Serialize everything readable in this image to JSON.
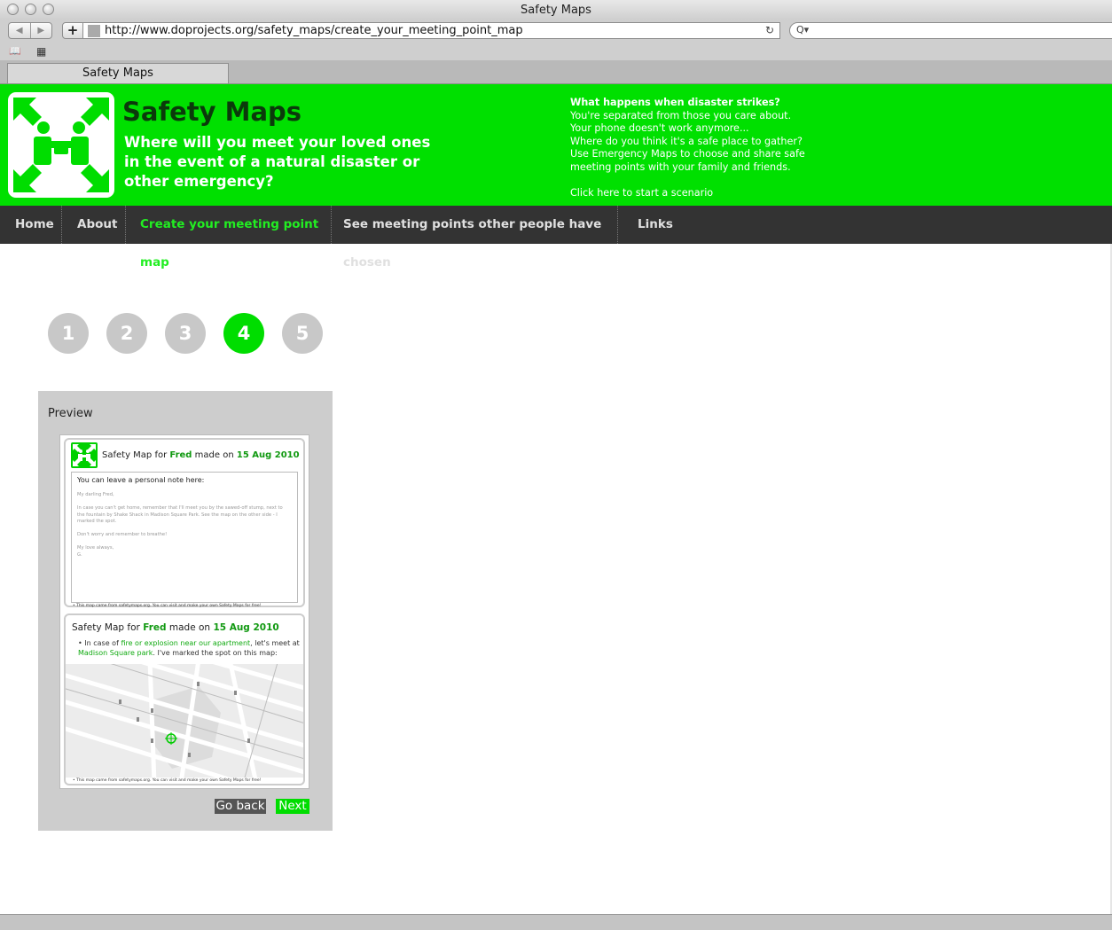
{
  "browser": {
    "window_title": "Safety Maps",
    "url": "http://www.doprojects.org/safety_maps/create_your_meeting_point_map",
    "tab_title": "Safety Maps",
    "back_glyph": "◀",
    "forward_glyph": "▶",
    "plus_glyph": "+",
    "reload_glyph": "↻",
    "search_glyph": "Q▾",
    "bookmarks_glyph": "📖",
    "topsites_glyph": "▦"
  },
  "header": {
    "title": "Safety Maps",
    "tagline": "Where will you meet your loved ones in the event of a natural disaster or other emergency?",
    "story_lines": [
      "What happens when disaster strikes?",
      "You're separated from those you care about.",
      "Your phone doesn't work anymore...",
      "Where do you think it's a safe place to gather?",
      "Use Emergency Maps to choose and share safe",
      "meeting points with your family and friends."
    ],
    "scenario_link": "Click here to start a scenario"
  },
  "nav": {
    "items": [
      {
        "label": "Home"
      },
      {
        "label": "About"
      },
      {
        "label": "Create your meeting point map"
      },
      {
        "label": "See meeting points other people have chosen"
      },
      {
        "label": "Links"
      }
    ],
    "active_index": 2
  },
  "steps": {
    "items": [
      "1",
      "2",
      "3",
      "4",
      "5"
    ],
    "current": "4"
  },
  "preview": {
    "title": "Preview",
    "card1": {
      "head_prefix": "Safety Map for",
      "name": "Fred",
      "made_on": "made on",
      "date": "15 Aug 2010",
      "note_label": "You can leave a personal note here:",
      "note_lines": [
        "My darling Fred,",
        "",
        "In case you can't get home, remember that I'll meet you by the sawed-off stump, next to the fountain by Shake Shack in Madison Square Park. See the map on the other side - I marked the spot.",
        "",
        "Don't worry and remember to breathe!",
        "",
        "My love always,",
        "G."
      ],
      "footnote": "• This map came from safetymaps.org. You can visit and make your own Safety Maps for free!"
    },
    "card2": {
      "head_prefix": "Safety Map for",
      "name": "Fred",
      "made_on": "made on",
      "date": "15 Aug 2010",
      "bullet_prefix": "• In case of",
      "situation": "fire or explosion near our apartment",
      "bullet_mid": ", let's meet at",
      "place": "Madison Square park",
      "bullet_suffix": ". I've marked the spot on this map:",
      "footnote": "• This map came from safetymaps.org. You can visit and make your own Safety Maps for free!"
    },
    "back_label": "Go back",
    "next_label": "Next"
  },
  "colors": {
    "brand_green": "#00e000",
    "nav_bg": "#333333",
    "nav_active": "#22ee22",
    "step_inactive": "#c8c8c8"
  }
}
